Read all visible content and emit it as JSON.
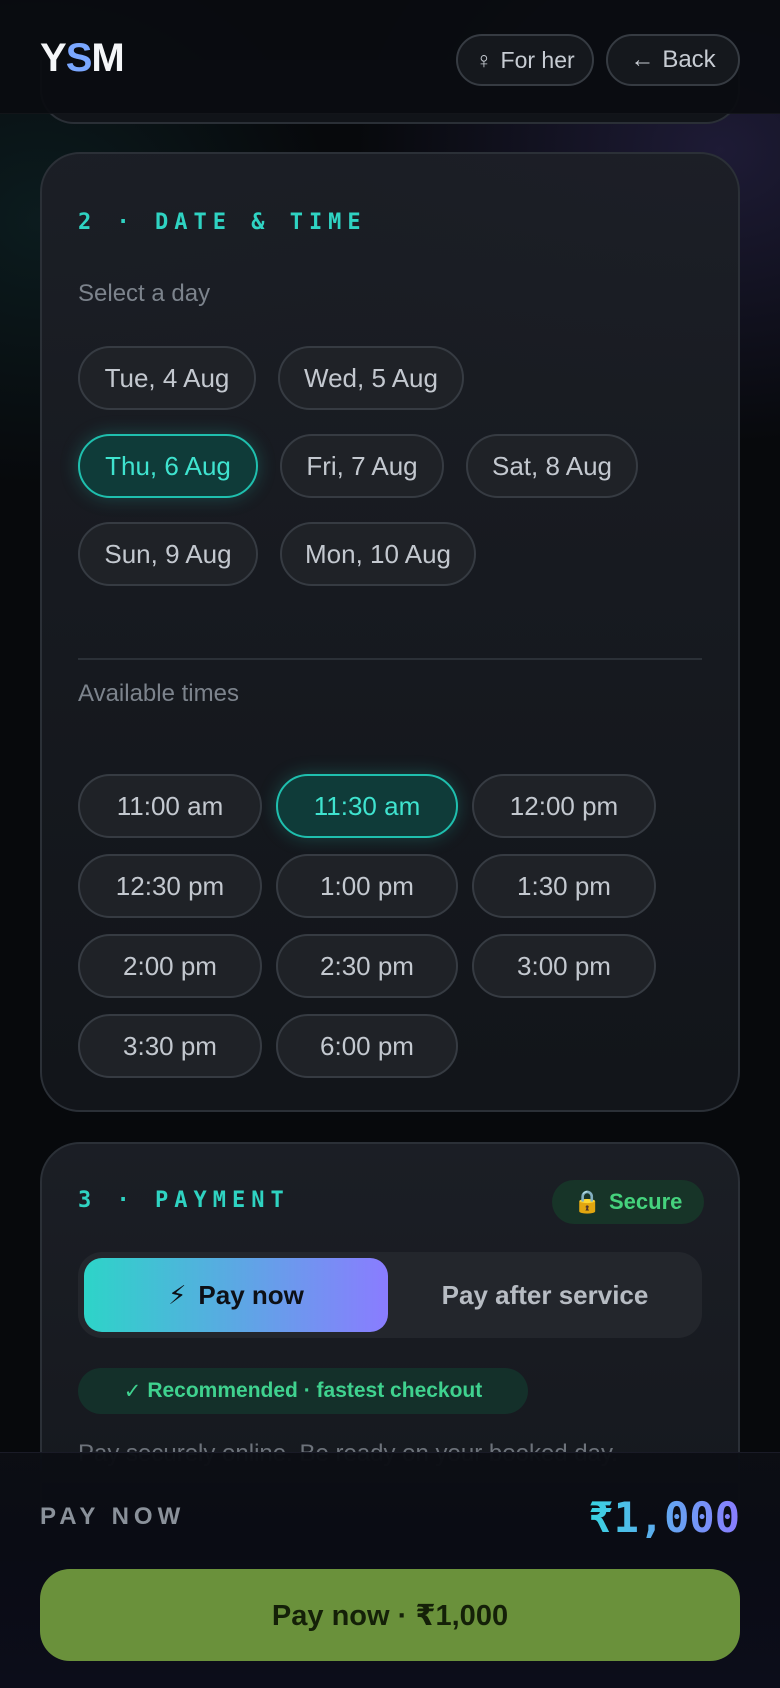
{
  "header": {
    "logo_prefix": "Y",
    "logo_accent": "S",
    "logo_suffix": "M",
    "for_her_icon": "♀",
    "for_her_label": "For her",
    "back_icon": "←",
    "back_label": "Back"
  },
  "date_time": {
    "title": "2 · DATE & TIME",
    "day_label": "Select a day",
    "days": [
      "Tue, 4 Aug",
      "Wed, 5 Aug",
      "Thu, 6 Aug",
      "Fri, 7 Aug",
      "Sat, 8 Aug",
      "Sun, 9 Aug",
      "Mon, 10 Aug"
    ],
    "selected_day": "Thu, 6 Aug",
    "time_label": "Available times",
    "times": [
      "11:00 am",
      "11:30 am",
      "12:00 pm",
      "12:30 pm",
      "1:00 pm",
      "1:30 pm",
      "2:00 pm",
      "2:30 pm",
      "3:00 pm",
      "3:30 pm",
      "6:00 pm"
    ],
    "selected_time": "11:30 am"
  },
  "payment": {
    "title": "3 · PAYMENT",
    "secure_icon": "🔒",
    "secure_label": "Secure",
    "pay_now_icon": "⚡",
    "pay_now_label": "Pay now",
    "pay_later_label": "Pay after service",
    "recommended_icon": "✓",
    "recommended_label": "Recommended · fastest checkout",
    "note": "Pay securely online. Be ready on your booked day."
  },
  "bottom_bar": {
    "label": "PAY NOW",
    "amount": "₹1,000",
    "cta_label": "Pay now · ₹1,000"
  },
  "colors": {
    "accent_teal": "#2fd3c2",
    "accent_purple": "#8a7cff",
    "cta_green": "#6a913b",
    "background": "#07090c"
  }
}
